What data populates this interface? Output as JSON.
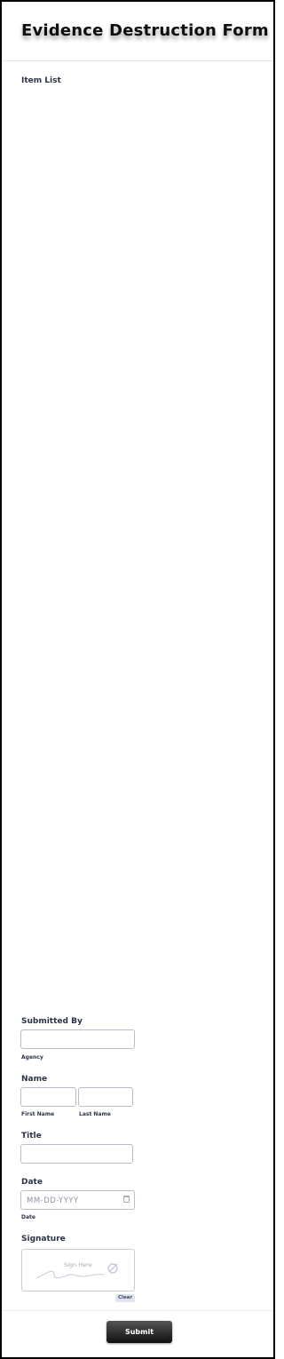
{
  "form": {
    "title": "Evidence Destruction Form",
    "item_list_label": "Item List",
    "submitted_by": {
      "label": "Submitted By",
      "agency_sublabel": "Agency"
    },
    "name": {
      "label": "Name",
      "first_sublabel": "First Name",
      "last_sublabel": "Last Name"
    },
    "title_field": {
      "label": "Title"
    },
    "date": {
      "label": "Date",
      "placeholder": "MM-DD-YYYY",
      "sublabel": "Date"
    },
    "signature": {
      "label": "Signature",
      "placeholder": "Sign Here",
      "clear_label": "Clear"
    },
    "submit_label": "Submit"
  }
}
